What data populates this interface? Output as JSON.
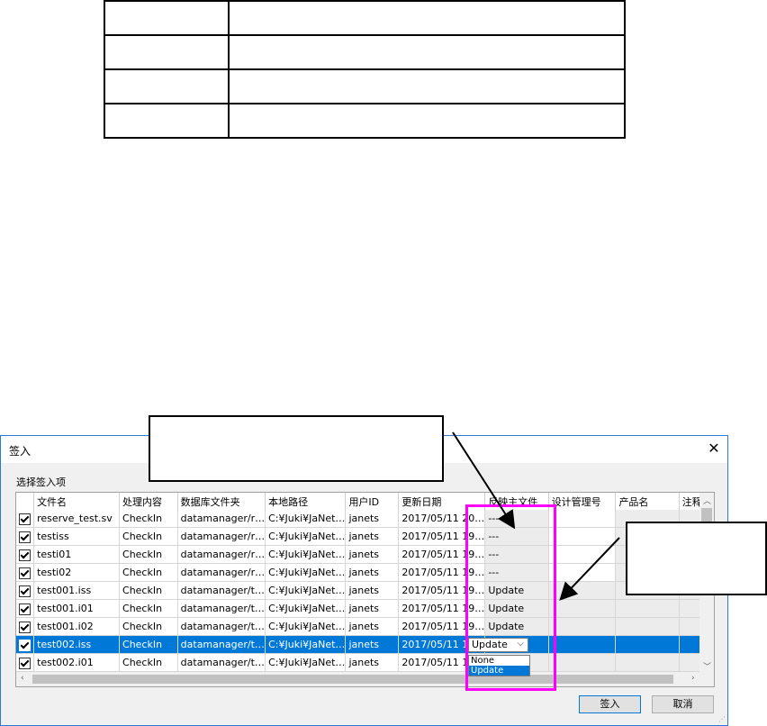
{
  "dialog": {
    "title": "签入",
    "group_label": "选择签入项",
    "columns": [
      "文件名",
      "处理内容",
      "数据库文件夹",
      "本地路径",
      "用户ID",
      "更新日期",
      "反映主文件",
      "设计管理号",
      "产品名",
      "注释"
    ],
    "rows": [
      {
        "checked": true,
        "name": "reserve_test.sv",
        "action": "CheckIn",
        "folder": "datamanager/r…",
        "path": "C:¥Juki¥JaNet…",
        "user": "janets",
        "date": "2017/05/11 20…",
        "reflect": "---",
        "selected": false
      },
      {
        "checked": true,
        "name": "testiss",
        "action": "CheckIn",
        "folder": "datamanager/r…",
        "path": "C:¥Juki¥JaNet…",
        "user": "janets",
        "date": "2017/05/11 19…",
        "reflect": "---",
        "selected": false
      },
      {
        "checked": true,
        "name": "testi01",
        "action": "CheckIn",
        "folder": "datamanager/r…",
        "path": "C:¥Juki¥JaNet…",
        "user": "janets",
        "date": "2017/05/11 19…",
        "reflect": "---",
        "selected": false
      },
      {
        "checked": true,
        "name": "testi02",
        "action": "CheckIn",
        "folder": "datamanager/r…",
        "path": "C:¥Juki¥JaNet…",
        "user": "janets",
        "date": "2017/05/11 19…",
        "reflect": "---",
        "selected": false
      },
      {
        "checked": true,
        "name": "test001.iss",
        "action": "CheckIn",
        "folder": "datamanager/t…",
        "path": "C:¥Juki¥JaNet…",
        "user": "janets",
        "date": "2017/05/11 19…",
        "reflect": "Update",
        "selected": false
      },
      {
        "checked": true,
        "name": "test001.i01",
        "action": "CheckIn",
        "folder": "datamanager/t…",
        "path": "C:¥Juki¥JaNet…",
        "user": "janets",
        "date": "2017/05/11 19…",
        "reflect": "Update",
        "selected": false
      },
      {
        "checked": true,
        "name": "test001.i02",
        "action": "CheckIn",
        "folder": "datamanager/t…",
        "path": "C:¥Juki¥JaNet…",
        "user": "janets",
        "date": "2017/05/11 19…",
        "reflect": "Update",
        "selected": false
      },
      {
        "checked": true,
        "name": "test002.iss",
        "action": "CheckIn",
        "folder": "datamanager/t…",
        "path": "C:¥Juki¥JaNet…",
        "user": "janets",
        "date": "2017/05/11 19…",
        "reflect": "",
        "selected": true
      },
      {
        "checked": true,
        "name": "test002.i01",
        "action": "CheckIn",
        "folder": "datamanager/t…",
        "path": "C:¥Juki¥JaNet…",
        "user": "janets",
        "date": "2017/05/11 19…",
        "reflect": "",
        "selected": false
      }
    ],
    "dropdown": {
      "value": "Update",
      "options": [
        "None",
        "Update"
      ],
      "highlighted": "Update"
    },
    "ok_label": "签入",
    "cancel_label": "取消"
  },
  "colors": {
    "selection": "#0078d7",
    "highlight_box": "#ff00ff"
  }
}
